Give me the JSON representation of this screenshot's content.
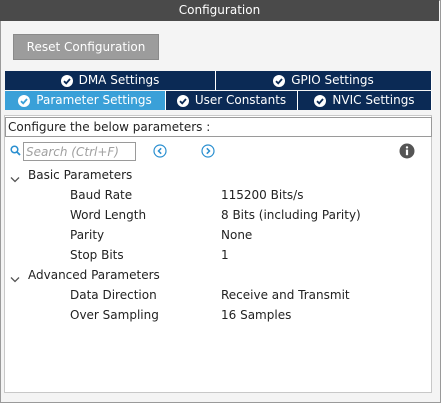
{
  "window": {
    "title": "Configuration"
  },
  "toolbar": {
    "reset_label": "Reset Configuration"
  },
  "tabs": {
    "dma": "DMA Settings",
    "gpio": "GPIO Settings",
    "parameter": "Parameter Settings",
    "user_constants": "User Constants",
    "nvic": "NVIC Settings",
    "active": "Parameter Settings"
  },
  "description": "Configure the below parameters :",
  "search": {
    "placeholder": "Search (Ctrl+F)",
    "value": ""
  },
  "groups": [
    {
      "label": "Basic Parameters",
      "expanded": true,
      "params": [
        {
          "name": "Baud Rate",
          "value": "115200 Bits/s"
        },
        {
          "name": "Word Length",
          "value": "8 Bits (including Parity)"
        },
        {
          "name": "Parity",
          "value": "None"
        },
        {
          "name": "Stop Bits",
          "value": "1"
        }
      ]
    },
    {
      "label": "Advanced Parameters",
      "expanded": true,
      "params": [
        {
          "name": "Data Direction",
          "value": "Receive and Transmit"
        },
        {
          "name": "Over Sampling",
          "value": "16 Samples"
        }
      ]
    }
  ],
  "colors": {
    "title_bar": "#4a4a4a",
    "tab_dark": "#0b2a55",
    "tab_active": "#3aa0d8",
    "accent": "#2a8fd0",
    "button": "#9c9c9c"
  },
  "icons": {
    "check": "check-circle-icon",
    "search": "search-icon",
    "prev": "chevron-left-circle-icon",
    "next": "chevron-right-circle-icon",
    "info": "info-icon",
    "expand": "chevron-down-icon"
  }
}
